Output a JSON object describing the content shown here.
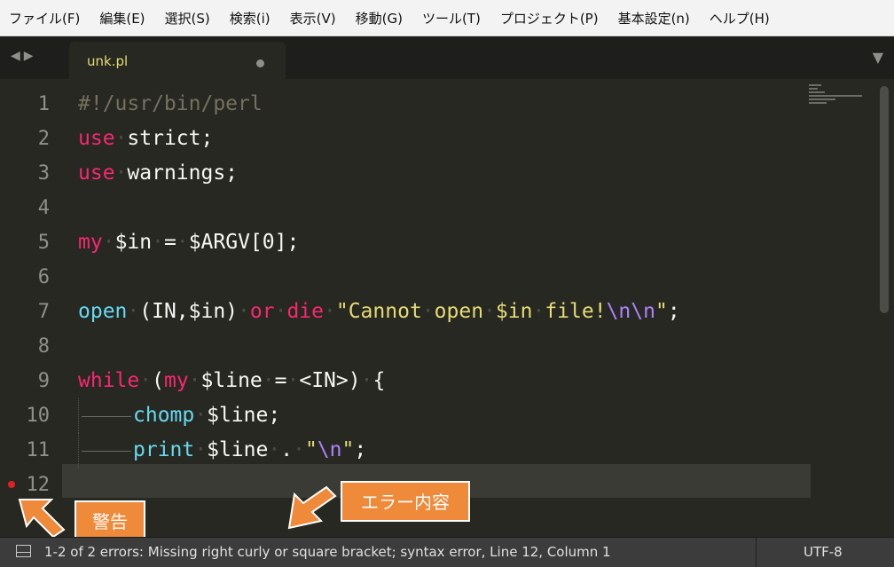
{
  "menu": [
    "ファイル(F)",
    "編集(E)",
    "選択(S)",
    "検索(i)",
    "表示(V)",
    "移動(G)",
    "ツール(T)",
    "プロジェクト(P)",
    "基本設定(n)",
    "ヘルプ(H)"
  ],
  "tab": {
    "title": "unk.pl"
  },
  "line_numbers": [
    "1",
    "2",
    "3",
    "4",
    "5",
    "6",
    "7",
    "8",
    "9",
    "10",
    "11",
    "12"
  ],
  "code": [
    [
      {
        "t": "#!/usr/bin/perl",
        "c": "cm"
      }
    ],
    [
      {
        "t": "use",
        "c": "kw"
      },
      {
        "t": "·",
        "c": "ws"
      },
      {
        "t": "strict;",
        "c": ""
      }
    ],
    [
      {
        "t": "use",
        "c": "kw"
      },
      {
        "t": "·",
        "c": "ws"
      },
      {
        "t": "warnings;",
        "c": ""
      }
    ],
    [],
    [
      {
        "t": "my",
        "c": "kw"
      },
      {
        "t": "·",
        "c": "ws"
      },
      {
        "t": "$in",
        "c": ""
      },
      {
        "t": "·",
        "c": "ws"
      },
      {
        "t": "=",
        "c": ""
      },
      {
        "t": "·",
        "c": "ws"
      },
      {
        "t": "$ARGV[0];",
        "c": ""
      }
    ],
    [],
    [
      {
        "t": "open",
        "c": "fn"
      },
      {
        "t": "·",
        "c": "ws"
      },
      {
        "t": "(IN,$in)",
        "c": ""
      },
      {
        "t": "·",
        "c": "ws"
      },
      {
        "t": "or",
        "c": "kw"
      },
      {
        "t": "·",
        "c": "ws"
      },
      {
        "t": "die",
        "c": "kw"
      },
      {
        "t": "·",
        "c": "ws"
      },
      {
        "t": "\"Cannot",
        "c": "str"
      },
      {
        "t": "·",
        "c": "ws"
      },
      {
        "t": "open",
        "c": "str"
      },
      {
        "t": "·",
        "c": "ws"
      },
      {
        "t": "$in",
        "c": "str"
      },
      {
        "t": "·",
        "c": "ws"
      },
      {
        "t": "file!",
        "c": "str"
      },
      {
        "t": "\\n\\n",
        "c": "esc"
      },
      {
        "t": "\"",
        "c": "str"
      },
      {
        "t": ";",
        "c": ""
      }
    ],
    [],
    [
      {
        "t": "while",
        "c": "kw"
      },
      {
        "t": "·",
        "c": "ws"
      },
      {
        "t": "(",
        "c": ""
      },
      {
        "t": "my",
        "c": "kw"
      },
      {
        "t": "·",
        "c": "ws"
      },
      {
        "t": "$line",
        "c": ""
      },
      {
        "t": "·",
        "c": "ws"
      },
      {
        "t": "=",
        "c": ""
      },
      {
        "t": "·",
        "c": "ws"
      },
      {
        "t": "<IN>)",
        "c": ""
      },
      {
        "t": "·",
        "c": "ws"
      },
      {
        "t": "{",
        "c": ""
      }
    ],
    [
      {
        "t": "chomp",
        "c": "fn"
      },
      {
        "t": "·",
        "c": "ws"
      },
      {
        "t": "$line;",
        "c": ""
      }
    ],
    [
      {
        "t": "print",
        "c": "fn"
      },
      {
        "t": "·",
        "c": "ws"
      },
      {
        "t": "$line",
        "c": ""
      },
      {
        "t": "·",
        "c": "ws"
      },
      {
        "t": ".",
        "c": ""
      },
      {
        "t": "·",
        "c": "ws"
      },
      {
        "t": "\"",
        "c": "str"
      },
      {
        "t": "\\n",
        "c": "esc"
      },
      {
        "t": "\"",
        "c": "str"
      },
      {
        "t": ";",
        "c": ""
      }
    ],
    []
  ],
  "annotations": {
    "warning_label": "警告",
    "error_label": "エラー内容"
  },
  "status": {
    "message": "1-2 of 2 errors: Missing right curly or square bracket; syntax error, Line 12, Column 1",
    "encoding": "UTF-8"
  },
  "colors": {
    "annotation": "#ee8a3a",
    "keyword": "#f92672",
    "function": "#66d9ef",
    "string": "#e6db74",
    "escape": "#ae81ff"
  }
}
